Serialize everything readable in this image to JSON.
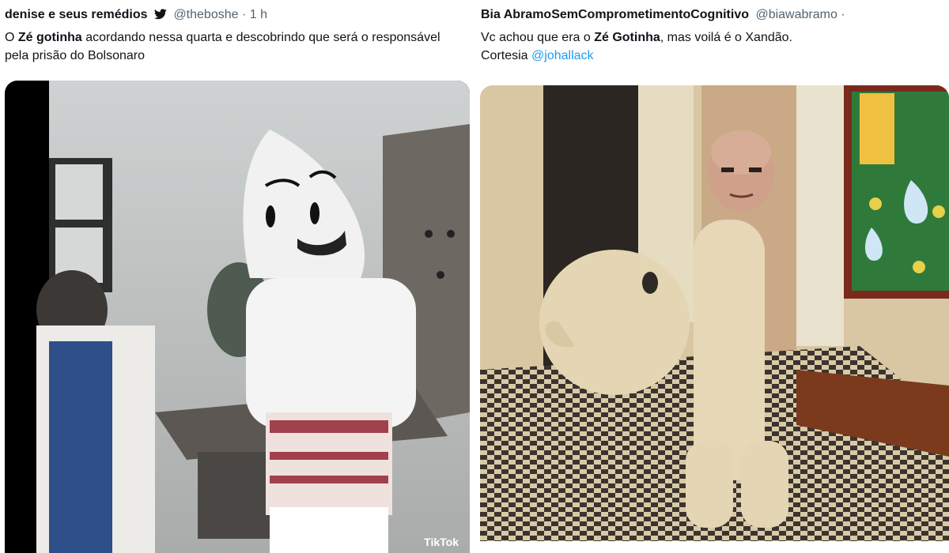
{
  "left_tweet": {
    "name": "denise e seus remédios",
    "handle_time": "@theboshe · 1 h",
    "text_bold": "Zé gotinha",
    "text_pre": "O ",
    "text_post": " acordando nessa quarta e descobrindo que será o responsável pela prisão do Bolsonaro",
    "watermark": "TikTok"
  },
  "right_tweet": {
    "name": "Bia AbramoSemComprometimentoCognitivo",
    "handle_time": "@biawabramo ·",
    "text_pre": "Vc achou que era o ",
    "text_bold": "Zé Gotinha",
    "text_post": ", mas voilá é o Xandão.",
    "line2_pre": "Cortesia ",
    "mention": "@johallack"
  },
  "colors": {
    "text": "#0f1419",
    "muted": "#536471",
    "link": "#1d9bf0"
  },
  "icons": {
    "bird": "twitter-bird-icon"
  }
}
